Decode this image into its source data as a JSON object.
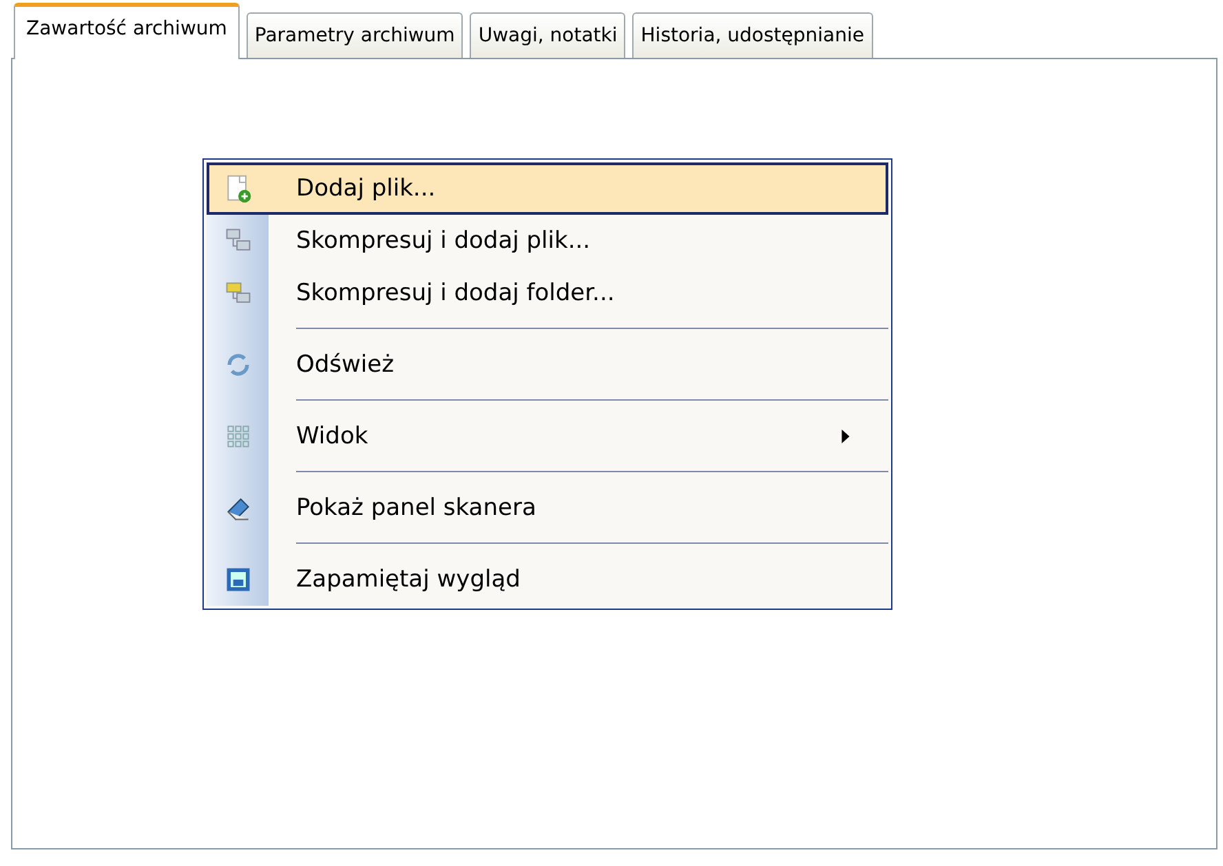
{
  "tabs": [
    {
      "label": "Zawartość archiwum",
      "selected": true
    },
    {
      "label": "Parametry archiwum",
      "selected": false
    },
    {
      "label": "Uwagi, notatki",
      "selected": false
    },
    {
      "label": "Historia, udostępnianie",
      "selected": false
    }
  ],
  "context_menu": {
    "items": [
      {
        "kind": "item",
        "label": "Dodaj plik...",
        "selected": true,
        "has_submenu": false
      },
      {
        "kind": "item",
        "label": "Skompresuj i dodaj plik...",
        "selected": false,
        "has_submenu": false
      },
      {
        "kind": "item",
        "label": "Skompresuj i dodaj folder...",
        "selected": false,
        "has_submenu": false
      },
      {
        "kind": "separator"
      },
      {
        "kind": "item",
        "label": "Odśwież",
        "selected": false,
        "has_submenu": false
      },
      {
        "kind": "separator"
      },
      {
        "kind": "item",
        "label": "Widok",
        "selected": false,
        "has_submenu": true
      },
      {
        "kind": "separator"
      },
      {
        "kind": "item",
        "label": "Pokaż panel skanera",
        "selected": false,
        "has_submenu": false
      },
      {
        "kind": "separator"
      },
      {
        "kind": "item",
        "label": "Zapamiętaj wygląd",
        "selected": false,
        "has_submenu": false
      }
    ]
  }
}
